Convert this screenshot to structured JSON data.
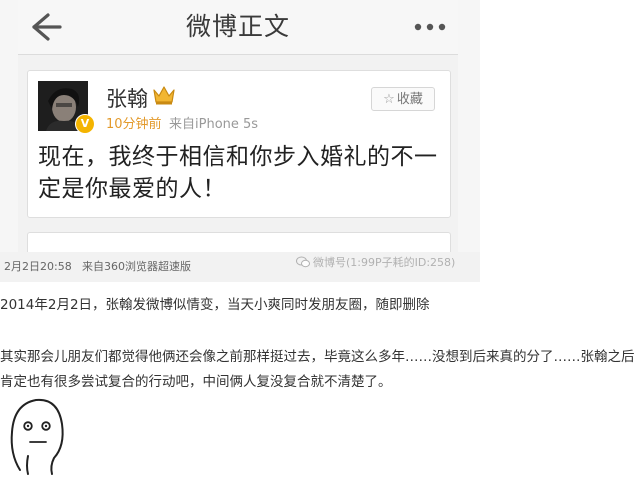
{
  "weibo": {
    "nav_title": "微博正文",
    "author_name": "张翰",
    "post_time": "10分钟前",
    "post_source": "来自iPhone 5s",
    "fav_icon": "☆",
    "fav_label": "收藏",
    "verified_mark": "V",
    "post_body": "现在，我终于相信和你步入婚礼的不一定是你最爱的人！",
    "meta_date": "2月2日20:58",
    "meta_client": "来自360浏览器超速版",
    "watermark": "微博号(1:99P子耗的ID:258)"
  },
  "article": {
    "caption": "2014年2月2日，张翰发微博似情变，当天小爽同时发朋友圈，随即删除",
    "paragraph": "其实那会儿朋友们都觉得他俩还会像之前那样挺过去，毕竟这么多年……没想到后来真的分了……张翰之后肯定也有很多尝试复合的行动吧，中间俩人复没复合就不清楚了。"
  },
  "colors": {
    "time_orange": "#e39a2b",
    "badge_gold": "#f4b400",
    "nav_bg": "#f7f7f7"
  }
}
